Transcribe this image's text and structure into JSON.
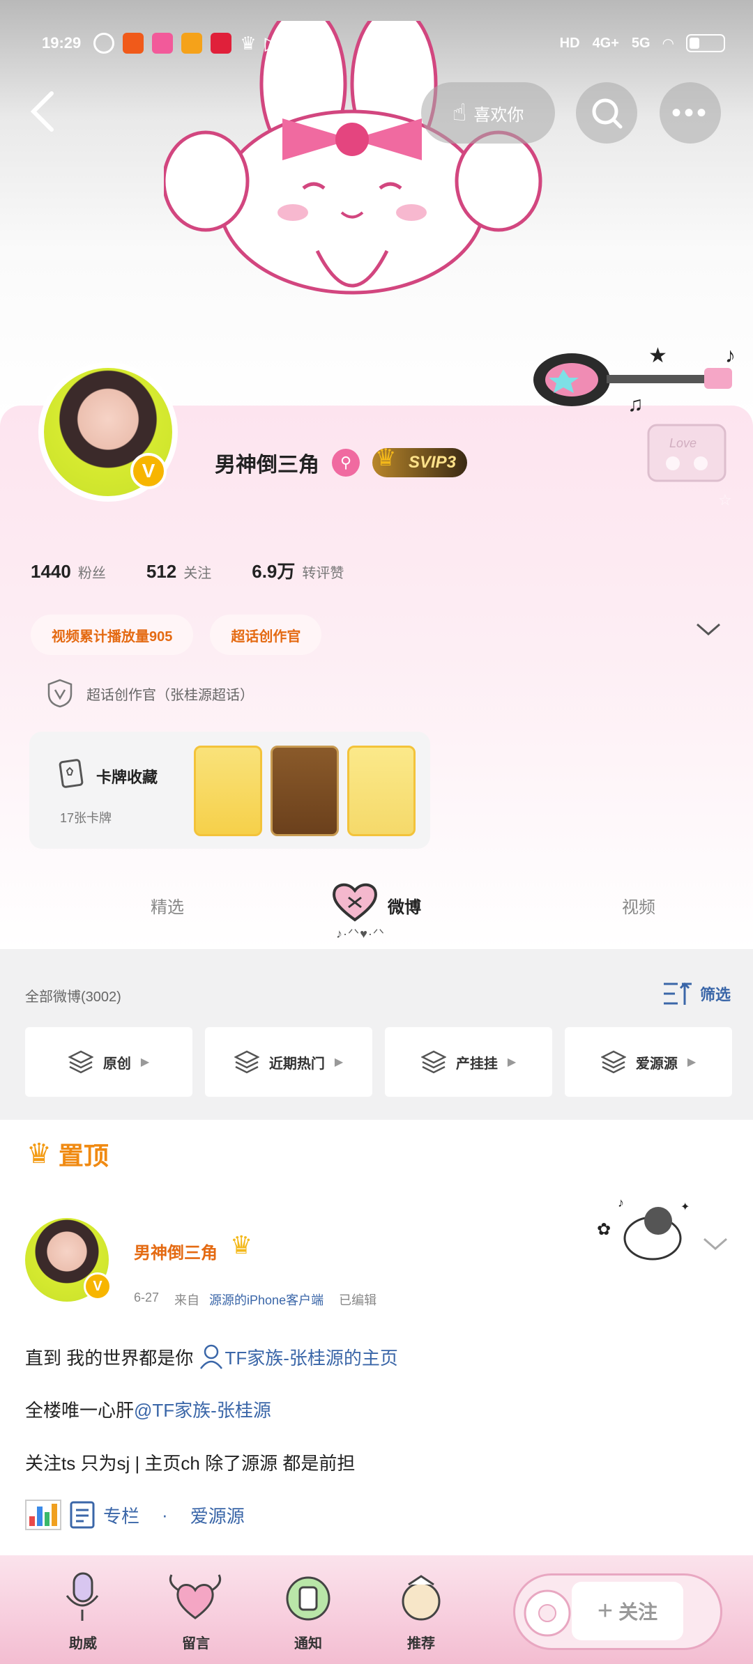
{
  "status_bar": {
    "time": "19:29",
    "net_label": "HD",
    "sig1": "4G+",
    "sig2": "5G"
  },
  "topbar": {
    "like_label": "喜欢你"
  },
  "profile": {
    "name": "男神倒三角",
    "vip_label": "SVIP3",
    "stats": [
      {
        "num": "1440",
        "label": "粉丝"
      },
      {
        "num": "512",
        "label": "关注"
      },
      {
        "num": "6.9万",
        "label": "转评赞"
      }
    ],
    "tags": [
      "视频累计播放量905",
      "超话创作官"
    ],
    "cert_text": "超话创作官（张桂源超话）",
    "cards": {
      "title": "卡牌收藏",
      "subtitle": "17张卡牌"
    }
  },
  "tabs": [
    {
      "label": "精选"
    },
    {
      "label": "微博"
    },
    {
      "label": "视频"
    }
  ],
  "feed": {
    "count_label": "全部微博(3002)",
    "filter_label": "筛选",
    "chips": [
      "原创",
      "近期热门",
      "产挂挂",
      "爱源源"
    ]
  },
  "pinned_label": "置顶",
  "post": {
    "author": "男神倒三角",
    "date": "6-27",
    "from_label": "来自",
    "source": "源源的iPhone客户端",
    "edited": "已编辑",
    "line1_text": "直到   我的世界都是你",
    "line1_link": "TF家族-张桂源的主页",
    "line2_text": "全楼唯一心肝",
    "line2_link": "@TF家族-张桂源",
    "line3_text": "关注ts    只为sj   |   主页ch   除了源源   都是前担",
    "line4_link1": "专栏",
    "line4_dot": "·",
    "line4_link2": "爱源源"
  },
  "bottom_nav": [
    {
      "label": "助威"
    },
    {
      "label": "留言"
    },
    {
      "label": "通知"
    },
    {
      "label": "推荐"
    }
  ],
  "follow_label": "关注",
  "colors": {
    "accent_orange": "#e46a12",
    "link_blue": "#3a66a8",
    "vip_gold": "#f7b500",
    "pink": "#f06aa0"
  }
}
